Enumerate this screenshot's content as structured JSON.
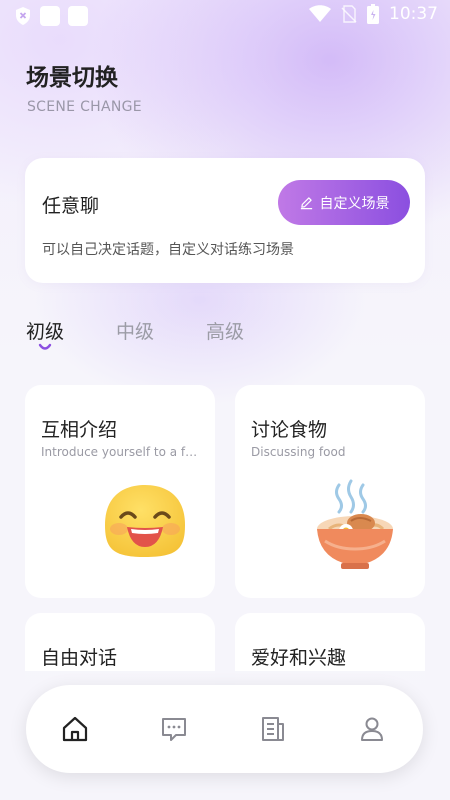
{
  "status_bar": {
    "time": "10:37",
    "icons": [
      "shield-x-icon",
      "notification-square-icon",
      "notification-square-icon",
      "wifi-icon",
      "no-sim-icon",
      "battery-icon"
    ]
  },
  "header": {
    "title": "场景切换",
    "subtitle": "SCENE CHANGE"
  },
  "free_chat": {
    "title": "任意聊",
    "description": "可以自己决定话题，自定义对话练习场景",
    "button_label": "自定义场景",
    "button_icon": "edit-pencil-icon"
  },
  "tabs": [
    {
      "label": "初级",
      "active": true
    },
    {
      "label": "中级",
      "active": false
    },
    {
      "label": "高级",
      "active": false
    }
  ],
  "scenes": [
    {
      "title": "互相介绍",
      "subtitle": "Introduce yourself to a friend",
      "icon": "smiling-face-icon"
    },
    {
      "title": "讨论食物",
      "subtitle": "Discussing food",
      "icon": "noodle-bowl-icon"
    },
    {
      "title": "自由对话",
      "subtitle": "",
      "icon": ""
    },
    {
      "title": "爱好和兴趣",
      "subtitle": "",
      "icon": ""
    }
  ],
  "bottom_nav": [
    {
      "icon": "home-icon",
      "active": true
    },
    {
      "icon": "chat-icon",
      "active": false
    },
    {
      "icon": "document-icon",
      "active": false
    },
    {
      "icon": "profile-icon",
      "active": false
    }
  ],
  "colors": {
    "accent_start": "#c079e6",
    "accent_end": "#8b4fe0",
    "text_primary": "#222222",
    "text_muted": "#9c9ca6"
  }
}
